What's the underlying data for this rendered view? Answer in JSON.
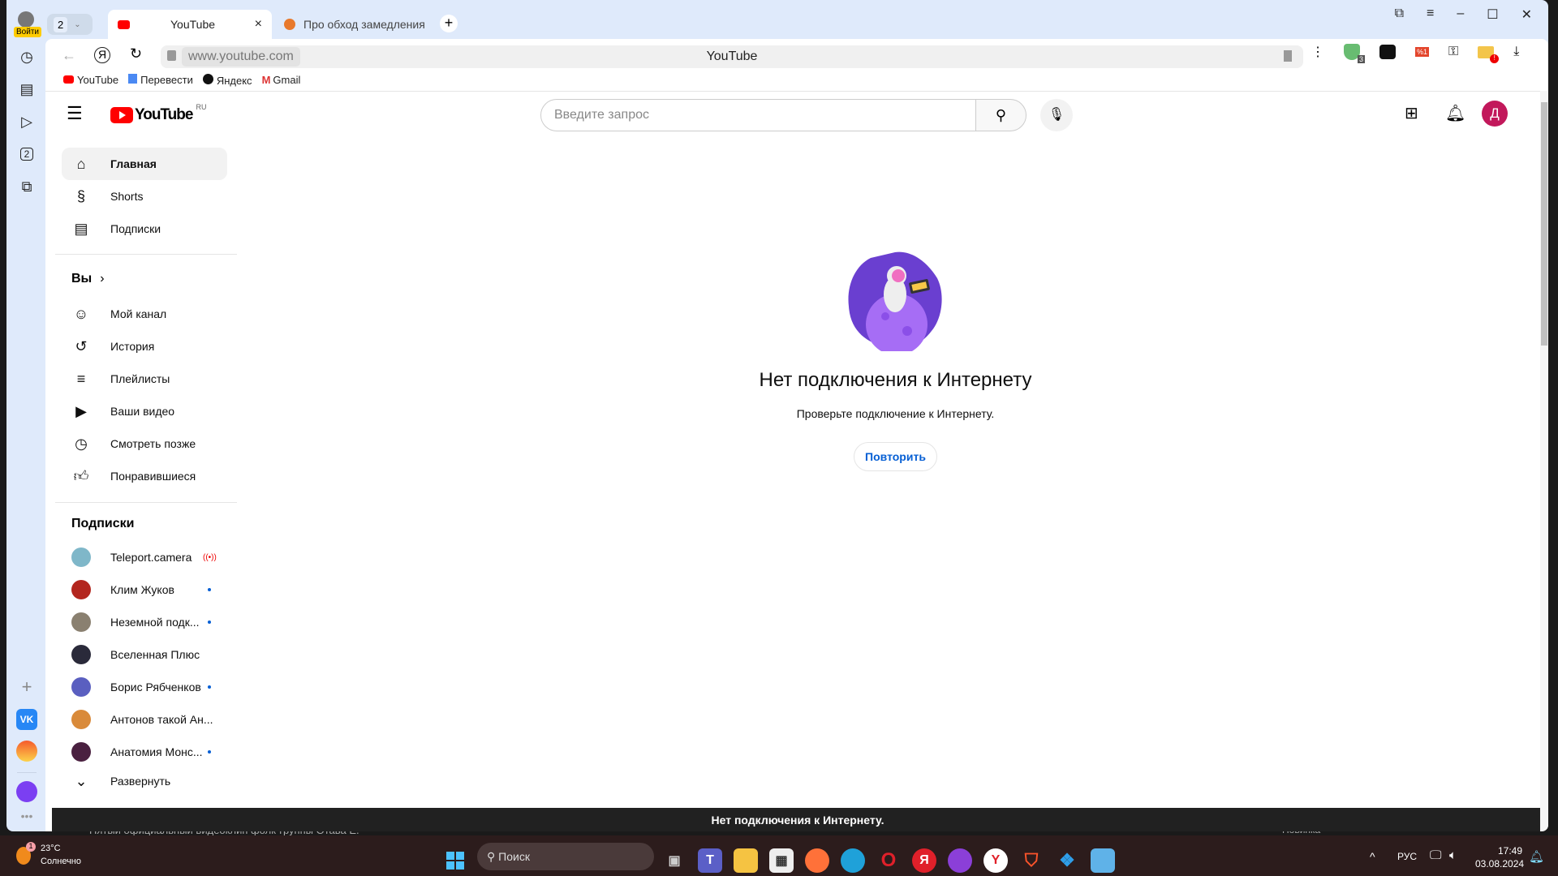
{
  "browser": {
    "login_label": "Войти",
    "tab_group_count": "2",
    "tabs": [
      {
        "title": "YouTube",
        "active": true
      },
      {
        "title": "Про обход замедления Yo",
        "active": false
      }
    ],
    "url": "www.youtube.com",
    "page_title": "YouTube",
    "bookmarks": [
      "YouTube",
      "Перевести",
      "Яндекс",
      "Gmail"
    ],
    "ext_badges": {
      "shield": "3",
      "sale": "%1",
      "folder": "!"
    },
    "sidebar_badge": "2"
  },
  "youtube": {
    "logo_text": "YouTube",
    "region": "RU",
    "search_placeholder": "Введите запрос",
    "avatar_letter": "Д",
    "nav_main": [
      {
        "label": "Главная",
        "icon": "home-icon"
      },
      {
        "label": "Shorts",
        "icon": "shorts-icon"
      },
      {
        "label": "Подписки",
        "icon": "subscriptions-icon"
      }
    ],
    "you_heading": "Вы",
    "nav_you": [
      {
        "label": "Мой канал",
        "icon": "channel-icon"
      },
      {
        "label": "История",
        "icon": "history-icon"
      },
      {
        "label": "Плейлисты",
        "icon": "playlists-icon"
      },
      {
        "label": "Ваши видео",
        "icon": "your-videos-icon"
      },
      {
        "label": "Смотреть позже",
        "icon": "watch-later-icon"
      },
      {
        "label": "Понравившиеся",
        "icon": "like-icon"
      }
    ],
    "subs_heading": "Подписки",
    "subscriptions": [
      {
        "name": "Teleport.camera",
        "status": "live",
        "color": "#7fb7c9"
      },
      {
        "name": "Клим Жуков",
        "status": "new",
        "color": "#b3261e"
      },
      {
        "name": "Неземной подк...",
        "status": "new",
        "color": "#8a8070"
      },
      {
        "name": "Вселенная Плюс",
        "status": "",
        "color": "#2a2a3a"
      },
      {
        "name": "Борис Рябченков",
        "status": "new",
        "color": "#5a5fc0"
      },
      {
        "name": "Антонов такой Ан...",
        "status": "",
        "color": "#d98a3a"
      },
      {
        "name": "Анатомия Монс...",
        "status": "new",
        "color": "#4a2040"
      }
    ],
    "expand_label": "Развернуть",
    "error_title": "Нет подключения к Интернету",
    "error_subtitle": "Проверьте подключение к Интернету.",
    "retry_label": "Повторить",
    "snackbar": "Нет подключения к Интернету.",
    "brand_color": "#ff0000",
    "accent_color": "#065fd4"
  },
  "background_text": {
    "video_caption": "Пятый официальный видеоклип фолк-группы Отава Ё.",
    "badge": "Новинка"
  },
  "taskbar": {
    "weather_temp": "23°C",
    "weather_desc": "Солнечно",
    "weather_badge": "1",
    "search_label": "Поиск",
    "lang": "РУС",
    "time": "17:49",
    "date": "03.08.2024"
  }
}
